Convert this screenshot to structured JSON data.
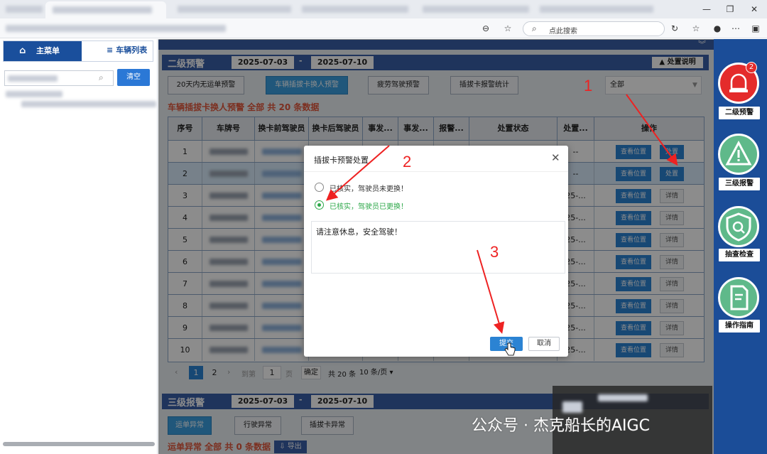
{
  "browser": {
    "search_placeholder": "点此搜索"
  },
  "left": {
    "main_menu": "主菜单",
    "vehicle_list": "车辆列表",
    "collapse_glyph": "《",
    "clear_button": "清空"
  },
  "main": {
    "level2": {
      "title": "二级预警",
      "date_start": "2025-07-03",
      "date_end": "2025-07-10",
      "date_sep": "-",
      "help_button": "处置说明",
      "tabs": [
        "20天内无运单预警",
        "车辆插拔卡换人预警",
        "疲劳驾驶预警",
        "插拔卡报警统计"
      ],
      "filter_value": "全部",
      "summary": "车辆插拔卡换人预警 全部 共 20 条数据"
    },
    "table": {
      "headers": [
        "序号",
        "车牌号",
        "换卡前驾驶员",
        "换卡后驾驶员",
        "事发...",
        "事发...",
        "报警...",
        "处置状态",
        "处置...",
        "操作"
      ],
      "rows": [
        {
          "no": "1",
          "time": "--",
          "btn1": "查看位置",
          "btn2": "处置"
        },
        {
          "no": "2",
          "time": "--",
          "btn1": "查看位置",
          "btn2": "处置"
        },
        {
          "no": "3",
          "time": "25-...",
          "btn1": "查看位置",
          "btn2": "详情"
        },
        {
          "no": "4",
          "time": "25-...",
          "btn1": "查看位置",
          "btn2": "详情"
        },
        {
          "no": "5",
          "time": "25-...",
          "btn1": "查看位置",
          "btn2": "详情"
        },
        {
          "no": "6",
          "time": "25-...",
          "btn1": "查看位置",
          "btn2": "详情"
        },
        {
          "no": "7",
          "time": "25-...",
          "btn1": "查看位置",
          "btn2": "详情"
        },
        {
          "no": "8",
          "time": "25-...",
          "btn1": "查看位置",
          "btn2": "详情"
        },
        {
          "no": "9",
          "time": "25-...",
          "btn1": "查看位置",
          "btn2": "详情"
        },
        {
          "no": "10",
          "time": "25-...",
          "btn1": "查看位置",
          "btn2": "详情"
        }
      ]
    },
    "pager": {
      "page1": "1",
      "page2": "2",
      "goto": "到第",
      "page_input": "1",
      "page_unit": "页",
      "confirm": "确定",
      "total": "共 20 条",
      "page_size": "10 条/页"
    },
    "level3": {
      "title": "三级报警",
      "date_start": "2025-07-03",
      "date_end": "2025-07-10",
      "date_sep": "-",
      "tabs": [
        "运单异常",
        "行驶异常",
        "插拔卡异常"
      ],
      "summary": "运单异常 全部 共 0 条数据",
      "export": "导出"
    }
  },
  "dialog": {
    "title": "插拔卡预警处置",
    "option1": "已核实，驾驶员未更换！",
    "option2": "已核实，驾驶员已更换！",
    "message": "请注意休息，安全驾驶！",
    "submit": "提交",
    "cancel": "取消"
  },
  "sidebar": {
    "badge": "2",
    "items": [
      "二级预警",
      "三级报警",
      "抽查检查",
      "操作指南"
    ]
  },
  "annotations": {
    "n1": "1",
    "n2": "2",
    "n3": "3"
  },
  "watermark": "公众号 · 杰克船长的AIGC",
  "colors": {
    "primary_blue": "#2b83d3",
    "header_blue": "#3a5fa8",
    "sidebar_blue": "#1b4d98",
    "alert_red": "#e22222",
    "selected_green": "#2ea84a"
  }
}
